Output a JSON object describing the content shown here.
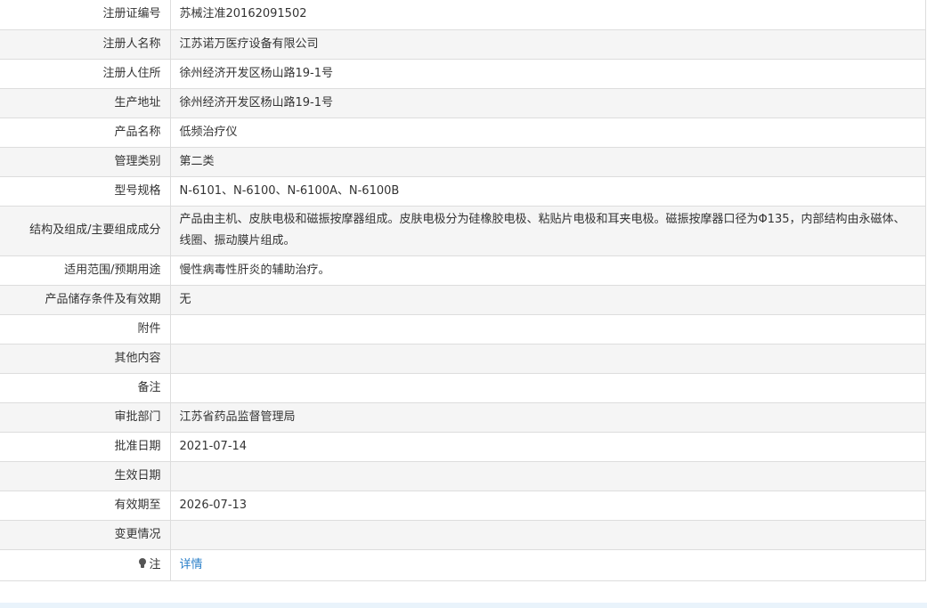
{
  "rows": [
    {
      "label": "注册证编号",
      "value": "苏械注准20162091502"
    },
    {
      "label": "注册人名称",
      "value": "江苏诺万医疗设备有限公司"
    },
    {
      "label": "注册人住所",
      "value": "徐州经济开发区杨山路19-1号"
    },
    {
      "label": "生产地址",
      "value": "徐州经济开发区杨山路19-1号"
    },
    {
      "label": "产品名称",
      "value": "低频治疗仪"
    },
    {
      "label": "管理类别",
      "value": "第二类"
    },
    {
      "label": "型号规格",
      "value": "N-6101、N-6100、N-6100A、N-6100B"
    },
    {
      "label": "结构及组成/主要组成成分",
      "value": "产品由主机、皮肤电极和磁振按摩器组成。皮肤电极分为硅橡胶电极、粘贴片电极和耳夹电极。磁振按摩器口径为Φ135，内部结构由永磁体、线圈、振动膜片组成。"
    },
    {
      "label": "适用范围/预期用途",
      "value": "慢性病毒性肝炎的辅助治疗。"
    },
    {
      "label": "产品储存条件及有效期",
      "value": "无"
    },
    {
      "label": "附件",
      "value": ""
    },
    {
      "label": "其他内容",
      "value": ""
    },
    {
      "label": "备注",
      "value": ""
    },
    {
      "label": "审批部门",
      "value": "江苏省药品监督管理局"
    },
    {
      "label": "批准日期",
      "value": "2021-07-14"
    },
    {
      "label": "生效日期",
      "value": ""
    },
    {
      "label": "有效期至",
      "value": "2026-07-13"
    },
    {
      "label": "变更情况",
      "value": ""
    }
  ],
  "note": {
    "icon": "lightbulb-icon",
    "label": "注",
    "link_text": "详情",
    "link_color": "#2a7fc9"
  },
  "colors": {
    "border": "#dddddd",
    "alt_row": "#f5f5f5",
    "text": "#333333"
  }
}
